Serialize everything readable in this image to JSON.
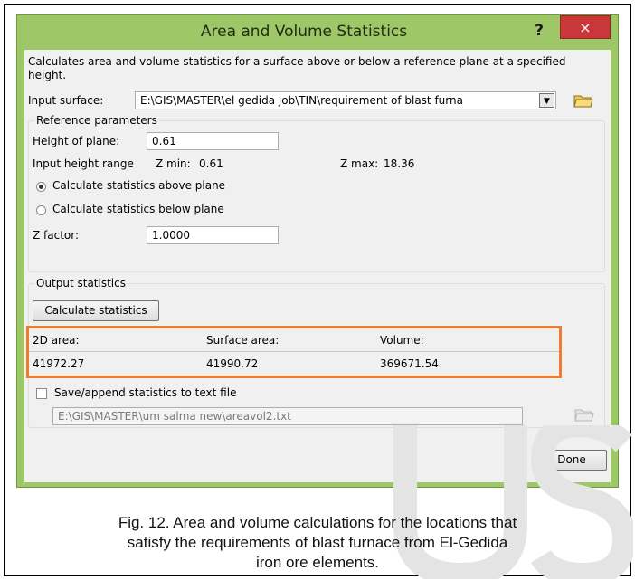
{
  "window": {
    "title": "Area and Volume Statistics",
    "help_label": "?",
    "close_label": "×"
  },
  "description": "Calculates area and volume statistics for a surface above or below a reference plane at a specified height.",
  "input_surface": {
    "label": "Input surface:",
    "value": "E:\\GIS\\MASTER\\el gedida job\\TIN\\requirement of blast furna"
  },
  "reference": {
    "group_title": "Reference parameters",
    "height_label": "Height of plane:",
    "height_value": "0.61",
    "range_label": "Input height range",
    "zmin_label": "Z min:",
    "zmin_value": "0.61",
    "zmax_label": "Z max:",
    "zmax_value": "18.36",
    "radio_above": "Calculate statistics above plane",
    "radio_below": "Calculate statistics below plane",
    "selected": "above",
    "zfactor_label": "Z factor:",
    "zfactor_value": "1.0000"
  },
  "output": {
    "group_title": "Output statistics",
    "calculate_label": "Calculate statistics",
    "headers": [
      "2D area:",
      "Surface area:",
      "Volume:"
    ],
    "values": [
      "41972.27",
      "41990.72",
      "369671.54"
    ]
  },
  "save": {
    "checkbox_label": "Save/append statistics to text file",
    "checked": false,
    "path": "E:\\GIS\\MASTER\\um salma new\\areavol2.txt"
  },
  "done_label": "Done",
  "caption": {
    "line1": "Fig. 12. Area and volume calculations for the locations that",
    "line2": "satisfy the requirements of blast furnace from El-Gedida",
    "line3": "iron ore elements."
  },
  "colors": {
    "titlebar": "#9ec868",
    "close_button": "#c9373a",
    "highlight_box": "#ed7d31"
  }
}
